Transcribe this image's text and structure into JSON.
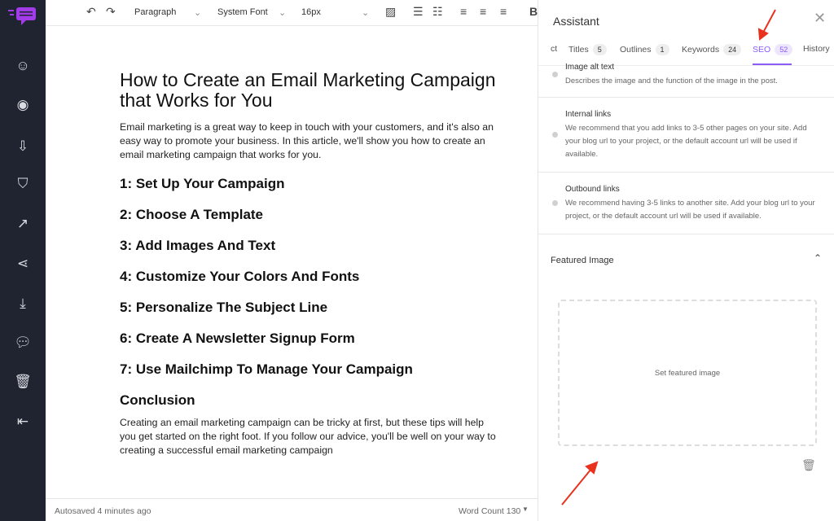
{
  "sidebar": {
    "items": [
      {
        "icon": "robot-icon"
      },
      {
        "icon": "eye-icon"
      },
      {
        "icon": "import-icon"
      },
      {
        "icon": "shield-check-icon"
      },
      {
        "icon": "external-link-icon"
      },
      {
        "icon": "share-icon"
      },
      {
        "icon": "download-icon"
      },
      {
        "icon": "chat-icon"
      },
      {
        "icon": "trash-icon"
      },
      {
        "icon": "logout-icon"
      }
    ]
  },
  "toolbar": {
    "block": "Paragraph",
    "font": "System Font",
    "size": "16px",
    "bold": "B"
  },
  "editor": {
    "title": "How to Create an Email Marketing Campaign that Works for You",
    "intro": "Email marketing is a great way to keep in touch with your customers, and it's also an easy way to promote your business. In this article, we'll show you how to create an email marketing campaign that works for you.",
    "headings": [
      "1: Set Up Your Campaign",
      "2: Choose A Template",
      "3: Add Images And Text",
      "4: Customize Your Colors And Fonts",
      "5: Personalize The Subject Line",
      "6: Create A Newsletter Signup Form",
      "7: Use Mailchimp To Manage Your Campaign",
      "Conclusion"
    ],
    "conclusion": "Creating an email marketing campaign can be tricky at first, but these tips will help you get started on the right foot. If you follow our advice, you'll be well on your way to creating a successful email marketing campaign"
  },
  "status": {
    "autosave": "Autosaved 4 minutes ago",
    "word_count": "Word Count 130"
  },
  "panel": {
    "title": "Assistant",
    "tabs": [
      {
        "label": "ct"
      },
      {
        "label": "Titles",
        "count": "5"
      },
      {
        "label": "Outlines",
        "count": "1"
      },
      {
        "label": "Keywords",
        "count": "24"
      },
      {
        "label": "SEO",
        "count": "52",
        "active": true
      },
      {
        "label": "History"
      }
    ],
    "items": [
      {
        "title": "Image alt text",
        "desc": "Describes the image and the function of the image in the post."
      },
      {
        "title": "Internal links",
        "desc": "We recommend that you add links to 3-5 other pages on your site. Add your blog url to your project, or the default account url will be used if available."
      },
      {
        "title": "Outbound links",
        "desc": "We recommend having 3-5 links to another site. Add your blog url to your project, or the default account url will be used if available."
      }
    ],
    "featured": {
      "heading": "Featured Image",
      "placeholder": "Set featured image"
    }
  },
  "colors": {
    "accent": "#8b5cf6",
    "sidebar": "#1f2430",
    "annotation": "#e8321e"
  }
}
